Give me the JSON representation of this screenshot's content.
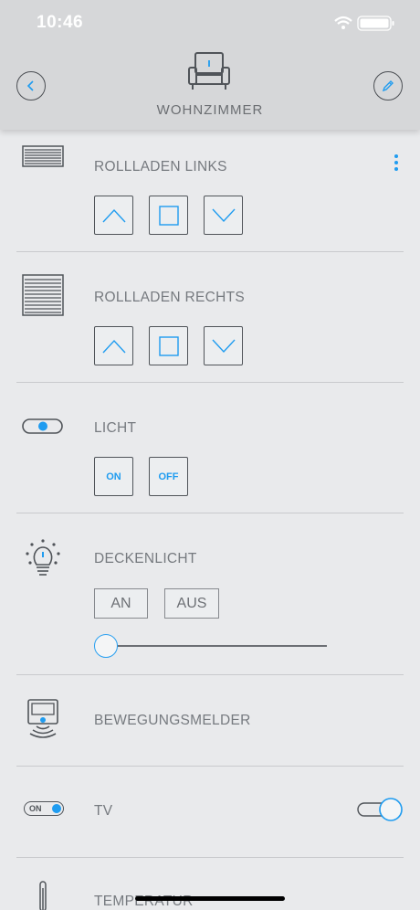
{
  "status": {
    "time": "10:46"
  },
  "header": {
    "title": "WOHNZIMMER"
  },
  "devices": [
    {
      "label": "ROLLLADEN LINKS"
    },
    {
      "label": "ROLLLADEN RECHTS"
    },
    {
      "label": "LICHT",
      "on_label": "ON",
      "off_label": "OFF"
    },
    {
      "label": "DECKENLICHT",
      "on_label": "AN",
      "off_label": "AUS",
      "dimmer_level_percent": 0
    },
    {
      "label": "BEWEGUNGSMELDER"
    },
    {
      "label": "TV",
      "icon_text": "ON",
      "toggle_on": true
    },
    {
      "label": "TEMPERATUR"
    }
  ],
  "colors": {
    "accent": "#1f9cf0",
    "header_bg": "#d6d7d9",
    "page_bg": "#e9eaec"
  }
}
